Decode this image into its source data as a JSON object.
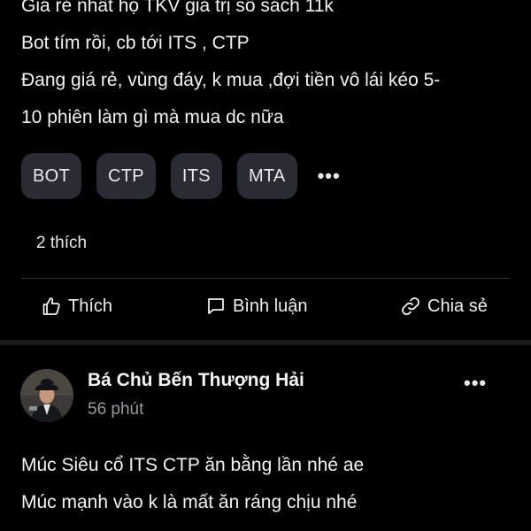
{
  "post1": {
    "lines": [
      "Giá rẻ nhất họ TKV giá trị sổ sách 11k",
      "Bot tím rồi, cb tới ITS , CTP",
      "Đang giá rẻ, vùng đáy, k mua ,đợi tiền vô lái kéo 5-",
      "10 phiên làm gì mà mua dc nữa"
    ],
    "tags": [
      "BOT",
      "CTP",
      "ITS",
      "MTA"
    ],
    "more_symbol": "•••",
    "likes_text": "2 thích"
  },
  "actions": {
    "like_label": "Thích",
    "comment_label": "Bình luận",
    "share_label": "Chia sẻ"
  },
  "post2": {
    "author": "Bá Chủ Bến Thượng Hải",
    "time": "56 phút",
    "more_symbol": "•••",
    "lines": [
      "Múc Siêu cổ ITS CTP ăn bằng lần nhé ae",
      "Múc mạnh vào k là mất ăn ráng chịu nhé"
    ]
  },
  "colors": {
    "background": "#000000",
    "tag_background": "#2a2c33",
    "muted_text": "#9a9a9e"
  },
  "icons": {
    "like": "thumbs-up-icon",
    "comment": "speech-bubble-icon",
    "share": "link-icon",
    "more": "ellipsis-icon"
  }
}
